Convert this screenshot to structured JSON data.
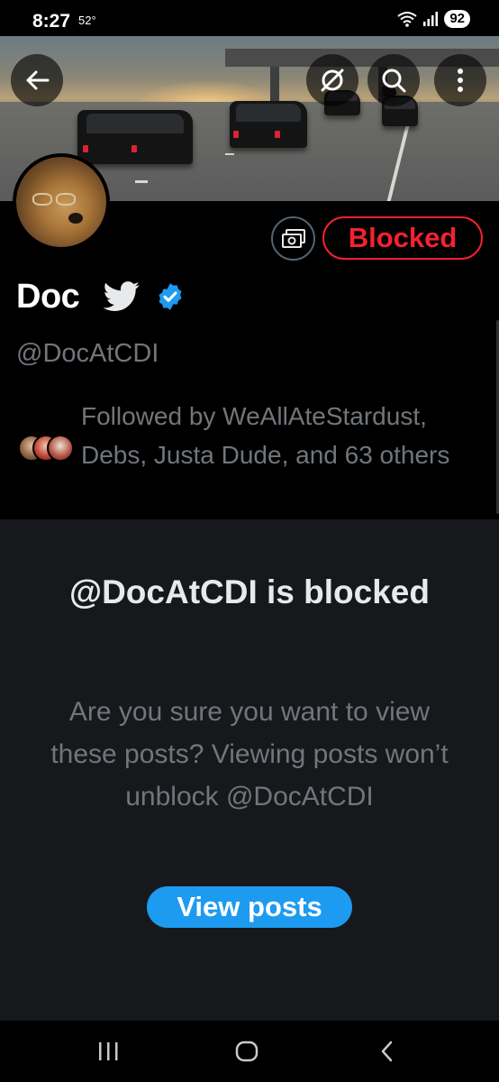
{
  "status_bar": {
    "time": "8:27",
    "temperature": "52°",
    "battery": "92",
    "icons": [
      "wifi-6-icon",
      "signal-icon"
    ]
  },
  "header": {
    "icons": [
      "back-arrow-icon",
      "no-signal-icon",
      "search-icon",
      "more-vertical-icon"
    ]
  },
  "profile": {
    "display_name": "Doc",
    "handle": "@DocAtCDI",
    "blocked_label": "Blocked",
    "followed_by": "Followed by WeAllAteStardust, Debs, Justa Dude, and 63 others",
    "colors": {
      "blocked_red": "#f4212e",
      "verified_blue": "#1d9bf0"
    }
  },
  "blocked_panel": {
    "title": "@DocAtCDI is blocked",
    "description": "Are you sure you want to view these posts? Viewing posts won’t unblock @DocAtCDI",
    "button_label": "View posts"
  },
  "nav_bar": {
    "icons": [
      "recent-apps-icon",
      "home-icon",
      "back-icon"
    ]
  }
}
